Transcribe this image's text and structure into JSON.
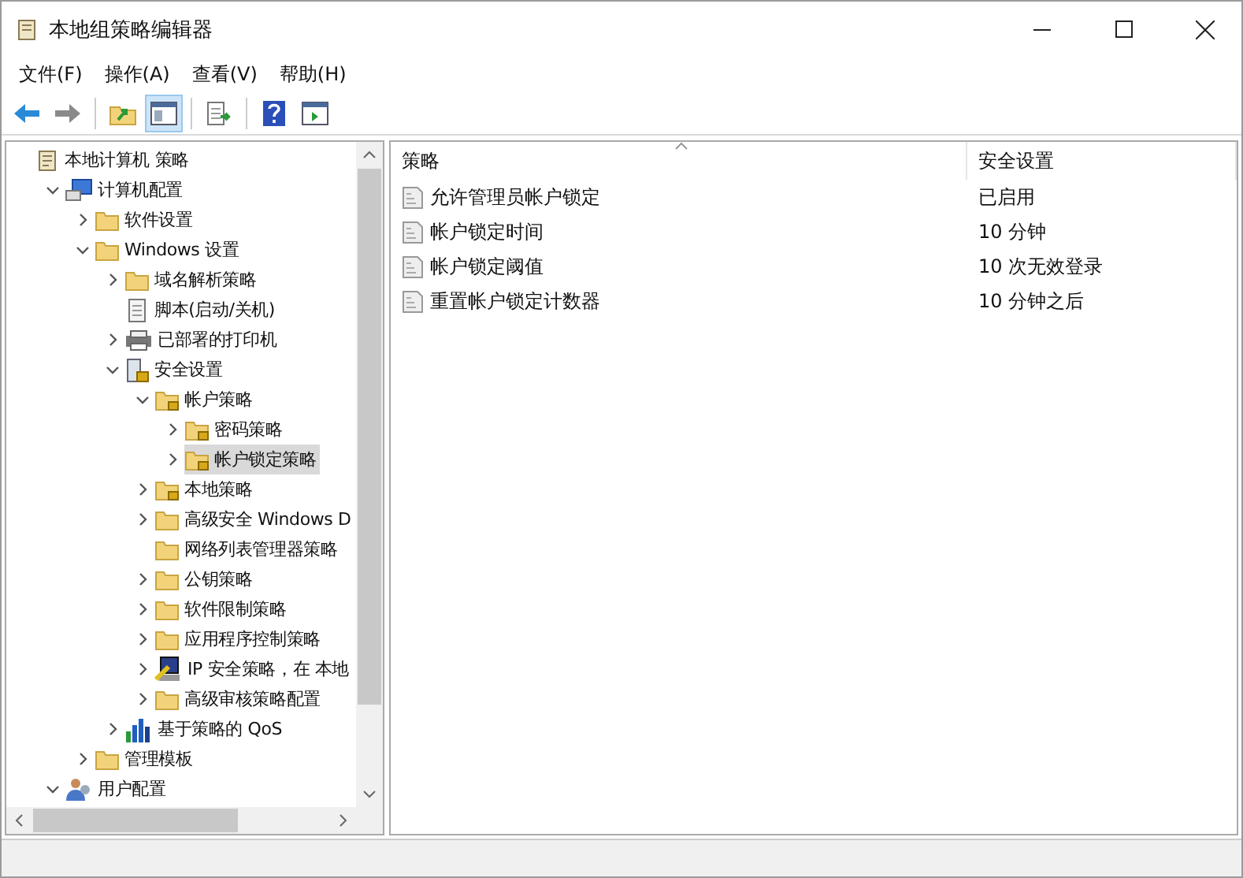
{
  "window": {
    "title": "本地组策略编辑器"
  },
  "menu": [
    "文件(F)",
    "操作(A)",
    "查看(V)",
    "帮助(H)"
  ],
  "toolbar": [
    {
      "kind": "back",
      "pressed": false
    },
    {
      "kind": "forward",
      "pressed": false
    },
    {
      "kind": "up",
      "pressed": false
    },
    {
      "kind": "tree",
      "pressed": true
    },
    {
      "kind": "export",
      "pressed": false
    },
    {
      "kind": "help",
      "pressed": false
    },
    {
      "kind": "view",
      "pressed": false
    }
  ],
  "tree": [
    {
      "label": "本地计算机 策略",
      "kind": "policy",
      "selected": false,
      "children": [
        {
          "label": "计算机配置",
          "kind": "computer",
          "expanded": true,
          "selected": false,
          "children": [
            {
              "label": "软件设置",
              "kind": "folder",
              "expanded": false,
              "selected": false
            },
            {
              "label": "Windows 设置",
              "kind": "folder",
              "expanded": true,
              "selected": false,
              "children": [
                {
                  "label": "域名解析策略",
                  "kind": "folder",
                  "expanded": false,
                  "selected": false
                },
                {
                  "label": "脚本(启动/关机)",
                  "kind": "script",
                  "selected": false
                },
                {
                  "label": "已部署的打印机",
                  "kind": "printer",
                  "expanded": false,
                  "selected": false
                },
                {
                  "label": "安全设置",
                  "kind": "security",
                  "expanded": true,
                  "selected": false,
                  "children": [
                    {
                      "label": "帐户策略",
                      "kind": "lockfolder",
                      "expanded": true,
                      "selected": false,
                      "children": [
                        {
                          "label": "密码策略",
                          "kind": "lockfolder",
                          "expanded": false,
                          "selected": false
                        },
                        {
                          "label": "帐户锁定策略",
                          "kind": "lockfolder",
                          "expanded": false,
                          "selected": true
                        }
                      ]
                    },
                    {
                      "label": "本地策略",
                      "kind": "lockfolder",
                      "expanded": false,
                      "selected": false
                    },
                    {
                      "label": "高级安全 Windows D",
                      "kind": "folder",
                      "expanded": false,
                      "selected": false
                    },
                    {
                      "label": "网络列表管理器策略",
                      "kind": "folder",
                      "selected": false
                    },
                    {
                      "label": "公钥策略",
                      "kind": "folder",
                      "expanded": false,
                      "selected": false
                    },
                    {
                      "label": "软件限制策略",
                      "kind": "folder",
                      "expanded": false,
                      "selected": false
                    },
                    {
                      "label": "应用程序控制策略",
                      "kind": "folder",
                      "expanded": false,
                      "selected": false
                    },
                    {
                      "label": "IP 安全策略，在 本地",
                      "kind": "ip",
                      "expanded": false,
                      "selected": false
                    },
                    {
                      "label": "高级审核策略配置",
                      "kind": "folder",
                      "expanded": false,
                      "selected": false
                    }
                  ]
                },
                {
                  "label": "基于策略的 QoS",
                  "kind": "chart",
                  "expanded": false,
                  "selected": false
                }
              ]
            },
            {
              "label": "管理模板",
              "kind": "folder",
              "expanded": false,
              "selected": false
            }
          ]
        },
        {
          "label": "用户配置",
          "kind": "user",
          "expanded": true,
          "selected": false
        }
      ]
    }
  ],
  "list": {
    "columns": [
      "策略",
      "安全设置"
    ],
    "rows": [
      {
        "policy": "允许管理员帐户锁定",
        "setting": "已启用"
      },
      {
        "policy": "帐户锁定时间",
        "setting": "10 分钟"
      },
      {
        "policy": "帐户锁定阈值",
        "setting": "10 次无效登录"
      },
      {
        "policy": "重置帐户锁定计数器",
        "setting": "10 分钟之后"
      }
    ]
  }
}
